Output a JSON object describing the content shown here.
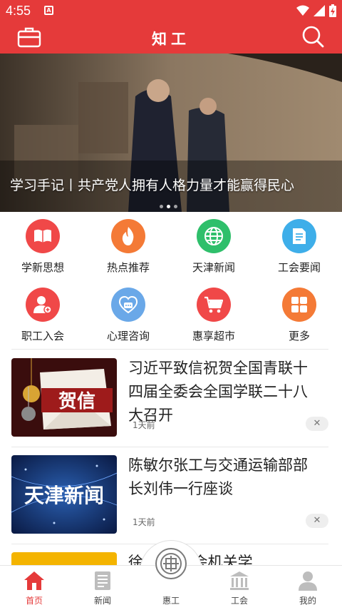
{
  "status_bar": {
    "time": "4:55",
    "notification_letter": "A"
  },
  "app_bar": {
    "title": "知工"
  },
  "banner": {
    "caption": "学习手记丨共产党人拥有人格力量才能赢得民心",
    "dots_total": 3,
    "dots_active": 2
  },
  "grid": {
    "items": [
      {
        "label": "学新思想",
        "color": "#f04848",
        "icon": "book-icon"
      },
      {
        "label": "热点推荐",
        "color": "#f47a36",
        "icon": "flame-icon"
      },
      {
        "label": "天津新闻",
        "color": "#2fbf6b",
        "icon": "globe-icon"
      },
      {
        "label": "工会要闻",
        "color": "#3eaee9",
        "icon": "document-icon"
      },
      {
        "label": "职工入会",
        "color": "#f04848",
        "icon": "add-user-icon"
      },
      {
        "label": "心理咨询",
        "color": "#6aa8e8",
        "icon": "heart-chat-icon"
      },
      {
        "label": "惠享超市",
        "color": "#f04848",
        "icon": "cart-icon"
      },
      {
        "label": "更多",
        "color": "#f47a36",
        "icon": "grid-more-icon"
      }
    ]
  },
  "news": [
    {
      "headline": "习近平致信祝贺全国青联十四届全委会全国学联二十八大召开",
      "time": "1天前",
      "close": "✕",
      "thumb_text": "贺信"
    },
    {
      "headline": "陈敏尔张工与交通运输部部长刘伟一行座谈",
      "time": "1天前",
      "close": "✕",
      "thumb_text": "天津新闻"
    }
  ],
  "partial_news": {
    "headline": "徐 国总工会机关学"
  },
  "tabbar": {
    "tabs": [
      {
        "label": "首页",
        "active": true
      },
      {
        "label": "新闻",
        "active": false
      },
      {
        "label": "惠工",
        "active": false
      },
      {
        "label": "工会",
        "active": false
      },
      {
        "label": "我的",
        "active": false
      }
    ]
  },
  "colors": {
    "brand_red": "#e53a3a",
    "tab_inactive": "#bdbdbd"
  }
}
